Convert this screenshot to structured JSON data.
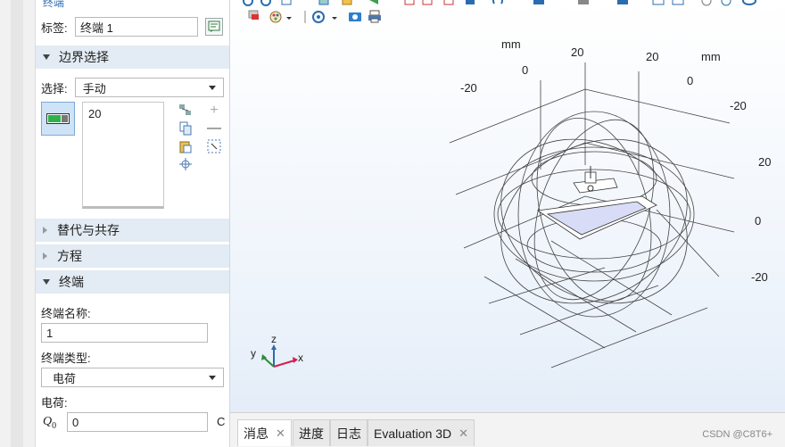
{
  "settings_panel": {
    "top_cut_label": "终端",
    "label_field_label": "标签:",
    "label_field_value": "终端 1",
    "boundary_section_title": "边界选择",
    "selection_label": "选择:",
    "selection_value": "手动",
    "selection_list": [
      "20"
    ],
    "override_section_title": "替代与共存",
    "equation_section_title": "方程",
    "terminal_section_title": "终端",
    "terminal_name_label": "终端名称:",
    "terminal_name_value": "1",
    "terminal_type_label": "终端类型:",
    "terminal_type_value": "电荷",
    "charge_label": "电荷:",
    "charge_symbol": "Q",
    "charge_subscript": "0",
    "charge_value": "0",
    "charge_unit": "C"
  },
  "graphics": {
    "axis_labels": {
      "mm_left": "mm",
      "mm_right": "mm",
      "top_n20": "-20",
      "top_0": "0",
      "top_20a": "20",
      "top_20b": "20",
      "top_0b": "0",
      "right_n20": "-20",
      "right_20": "20",
      "right_0": "0",
      "right_n20b": "-20"
    },
    "triad": {
      "x": "x",
      "y": "y",
      "z": "z"
    }
  },
  "bottom_tabs": [
    {
      "label": "消息",
      "closable": true,
      "active": true
    },
    {
      "label": "进度",
      "closable": false,
      "active": false
    },
    {
      "label": "日志",
      "closable": false,
      "active": false
    },
    {
      "label": "Evaluation 3D",
      "closable": true,
      "active": false
    }
  ],
  "watermark": "CSDN @C8T6+"
}
